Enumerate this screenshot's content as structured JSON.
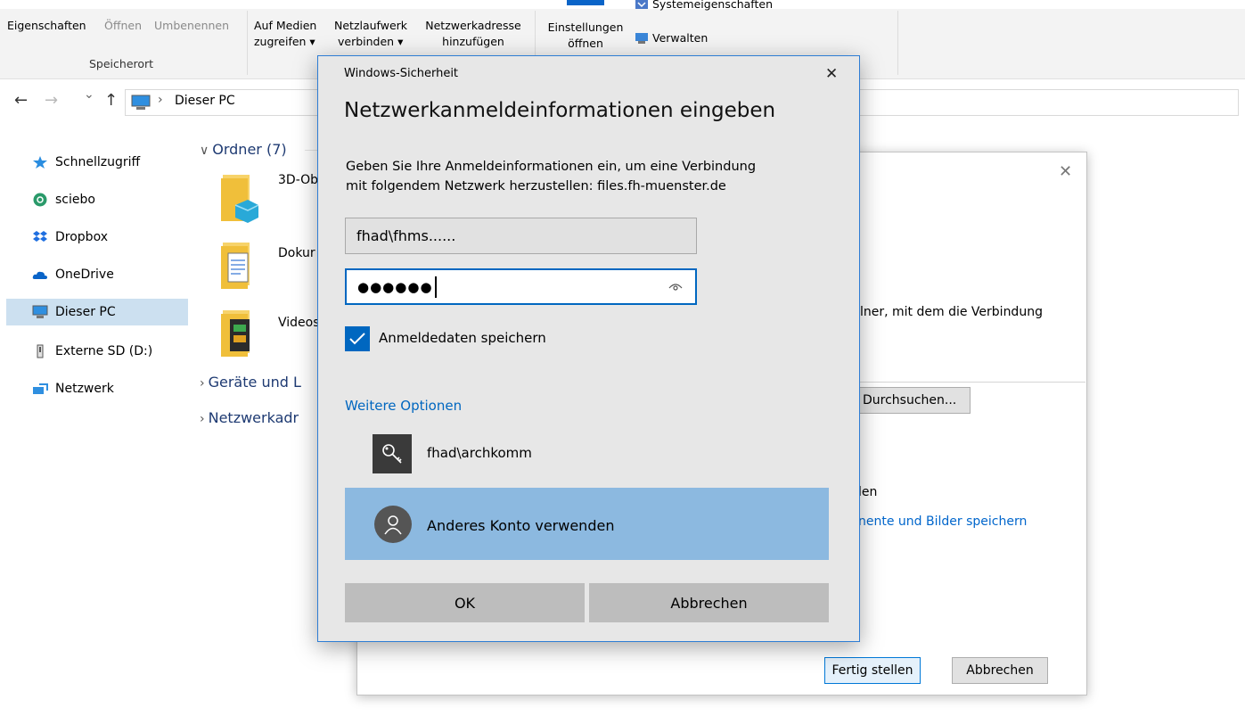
{
  "ribbon": {
    "properties": "Eigenschaften",
    "open": "Öffnen",
    "rename": "Umbenennen",
    "media_line1": "Auf Medien",
    "media_line2": "zugreifen ▾",
    "netdrive_line1": "Netzlaufwerk",
    "netdrive_line2": "verbinden ▾",
    "netaddr_line1": "Netzwerkadresse",
    "netaddr_line2": "hinzufügen",
    "settings_line1": "Einstellungen",
    "settings_line2": "öffnen",
    "sysprops": "Systemeigenschaften",
    "manage": "Verwalten",
    "group_location": "Speicherort"
  },
  "address": {
    "back": "←",
    "forward": "→",
    "recent": "⌄",
    "up": "↑",
    "separator": "›",
    "path": "Dieser PC"
  },
  "sidebar": {
    "items": [
      {
        "label": "Schnellzugriff",
        "icon": "star-icon"
      },
      {
        "label": "sciebo",
        "icon": "sciebo-icon"
      },
      {
        "label": "Dropbox",
        "icon": "dropbox-icon"
      },
      {
        "label": "OneDrive",
        "icon": "cloud-icon"
      },
      {
        "label": "Dieser PC",
        "icon": "computer-icon",
        "selected": true
      },
      {
        "label": "Externe SD (D:)",
        "icon": "drive-icon"
      },
      {
        "label": "Netzwerk",
        "icon": "network-icon"
      }
    ]
  },
  "content": {
    "folders_header": "Ordner (7)",
    "devices_header": "Geräte und L",
    "netaddr_header": "Netzwerkadr",
    "folders": [
      "3D-Ob",
      "Dokur",
      "Videos"
    ]
  },
  "wizard": {
    "text_fragment": "lner, mit dem die Verbindung",
    "browse": "Durchsuchen...",
    "fragment_en": "len",
    "link_fragment": "nente und Bilder speichern",
    "finish": "Fertig stellen",
    "cancel": "Abbrechen",
    "close": "✕"
  },
  "security": {
    "app_title": "Windows-Sicherheit",
    "close": "✕",
    "heading": "Netzwerkanmeldeinformationen eingeben",
    "description_line1": "Geben Sie Ihre Anmeldeinformationen ein, um eine Verbindung",
    "description_line2": "mit folgendem Netzwerk herzustellen: files.fh-muenster.de",
    "username_value": "fhad\\fhms......",
    "password_value": "●●●●●●",
    "remember_label": "Anmeldedaten speichern",
    "remember_checked": true,
    "more_options": "Weitere Optionen",
    "account_saved": "fhad\\archkomm",
    "account_other": "Anderes Konto verwenden",
    "ok": "OK",
    "cancel": "Abbrechen",
    "accent": "#0067c0",
    "selected_bg": "#8cb9e0"
  }
}
